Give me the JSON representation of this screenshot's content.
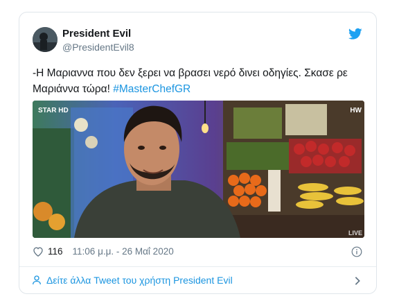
{
  "tweet": {
    "display_name": "President Evil",
    "handle": "@PresidentEvil8",
    "text_main": "-Η Μαριαννα που δεν ξερει να βρασει νερό δινει οδηγίες. Σκασε ρε Μαριάννα τώρα! ",
    "hashtag": "#MasterChefGR",
    "media": {
      "channel_logo": "STAR HD",
      "corner_tag": "HW",
      "live_tag": "LIVE"
    },
    "likes": "116",
    "timestamp": "11:06 μ.μ. - 26 Μαΐ 2020",
    "footer_link": "Δείτε άλλα Tweet του χρήστη President Evil"
  },
  "colors": {
    "accent": "#1b95e0",
    "text_primary": "#14171a",
    "text_secondary": "#657786",
    "border": "#dfe5ea"
  },
  "icons": [
    "twitter-bird-icon",
    "heart-icon",
    "info-icon",
    "user-icon",
    "chevron-right-icon"
  ]
}
